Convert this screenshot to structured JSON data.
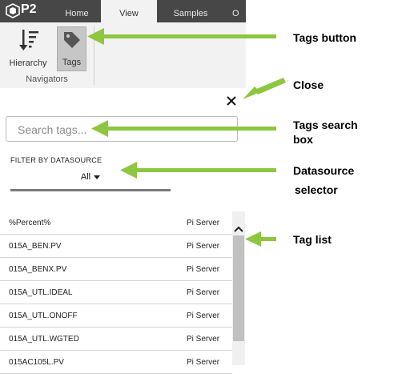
{
  "ribbon": {
    "logo_text": "P2",
    "tabs": [
      {
        "label": "Home"
      },
      {
        "label": "View"
      },
      {
        "label": "Samples"
      },
      {
        "label": "O"
      }
    ],
    "tools": [
      {
        "label": "Hierarchy",
        "icon": "hierarchy-icon"
      },
      {
        "label": "Tags",
        "icon": "tag-icon"
      }
    ],
    "group_label": "Navigators",
    "bar_color": "#474747"
  },
  "panel": {
    "close_icon": "close-icon",
    "search": {
      "placeholder": "Search tags...",
      "value": ""
    },
    "filter_label": "FILTER BY DATASOURCE",
    "datasource_selected": "All"
  },
  "tag_list": {
    "rows": [
      {
        "name": "%Percent%",
        "source": "Pi Server"
      },
      {
        "name": "015A_BEN.PV",
        "source": "Pi Server"
      },
      {
        "name": "015A_BENX.PV",
        "source": "Pi Server"
      },
      {
        "name": "015A_UTL.IDEAL",
        "source": "Pi Server"
      },
      {
        "name": "015A_UTL.ONOFF",
        "source": "Pi Server"
      },
      {
        "name": "015A_UTL.WGTED",
        "source": "Pi Server"
      },
      {
        "name": "015AC105L.PV",
        "source": "Pi Server"
      }
    ]
  },
  "annotations": {
    "tags_button": "Tags button",
    "close": "Close",
    "search_line1": "Tags search",
    "search_line2": "box",
    "datasource_line1": "Datasource",
    "datasource_line2": "selector",
    "tag_list": "Tag list",
    "arrow_color": "#8dc63f"
  }
}
